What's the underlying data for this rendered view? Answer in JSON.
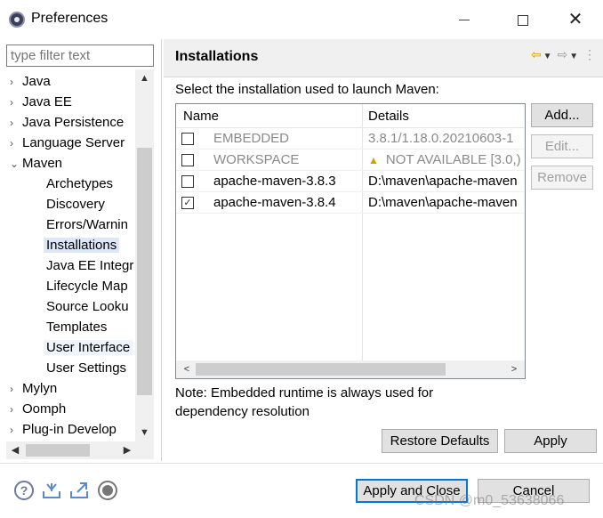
{
  "window": {
    "title": "Preferences",
    "controls": [
      "minimize",
      "maximize",
      "close"
    ]
  },
  "filter": {
    "placeholder": "type filter text",
    "value": ""
  },
  "tree": {
    "items": [
      {
        "label": "Java",
        "expanded": false,
        "level": 0
      },
      {
        "label": "Java EE",
        "expanded": false,
        "level": 0
      },
      {
        "label": "Java Persistence",
        "expanded": false,
        "level": 0
      },
      {
        "label": "Language Server",
        "expanded": false,
        "level": 0
      },
      {
        "label": "Maven",
        "expanded": true,
        "level": 0
      },
      {
        "label": "Archetypes",
        "level": 1
      },
      {
        "label": "Discovery",
        "level": 1
      },
      {
        "label": "Errors/Warnin",
        "level": 1
      },
      {
        "label": "Installations",
        "level": 1,
        "selected": true
      },
      {
        "label": "Java EE Integr",
        "level": 1
      },
      {
        "label": "Lifecycle Map",
        "level": 1
      },
      {
        "label": "Source Looku",
        "level": 1
      },
      {
        "label": "Templates",
        "level": 1
      },
      {
        "label": "User Interface",
        "level": 1,
        "hover": true
      },
      {
        "label": "User Settings",
        "level": 1
      },
      {
        "label": "Mylyn",
        "expanded": false,
        "level": 0
      },
      {
        "label": "Oomph",
        "expanded": false,
        "level": 0
      },
      {
        "label": "Plug-in Develop",
        "expanded": false,
        "level": 0
      }
    ]
  },
  "page": {
    "title": "Installations",
    "instruction": "Select the installation used to launch Maven:",
    "columns": {
      "name": "Name",
      "details": "Details"
    },
    "rows": [
      {
        "name": "EMBEDDED",
        "details": "3.8.1/1.18.0.20210603-1",
        "checked": false,
        "disabled": true,
        "warning": false
      },
      {
        "name": "WORKSPACE",
        "details": "NOT AVAILABLE [3.0,)",
        "checked": false,
        "disabled": true,
        "warning": true
      },
      {
        "name": "apache-maven-3.8.3",
        "details": "D:\\maven\\apache-maven",
        "checked": false,
        "disabled": false,
        "warning": false
      },
      {
        "name": "apache-maven-3.8.4",
        "details": "D:\\maven\\apache-maven",
        "checked": true,
        "disabled": false,
        "warning": false
      }
    ],
    "buttons": {
      "add": "Add...",
      "edit": "Edit...",
      "remove": "Remove"
    },
    "note": "Note: Embedded runtime is always used for dependency resolution",
    "restore_defaults": "Restore Defaults",
    "apply": "Apply"
  },
  "footer": {
    "apply_and_close": "Apply and Close",
    "cancel": "Cancel",
    "watermark": "CSDN @m0_53638066"
  }
}
